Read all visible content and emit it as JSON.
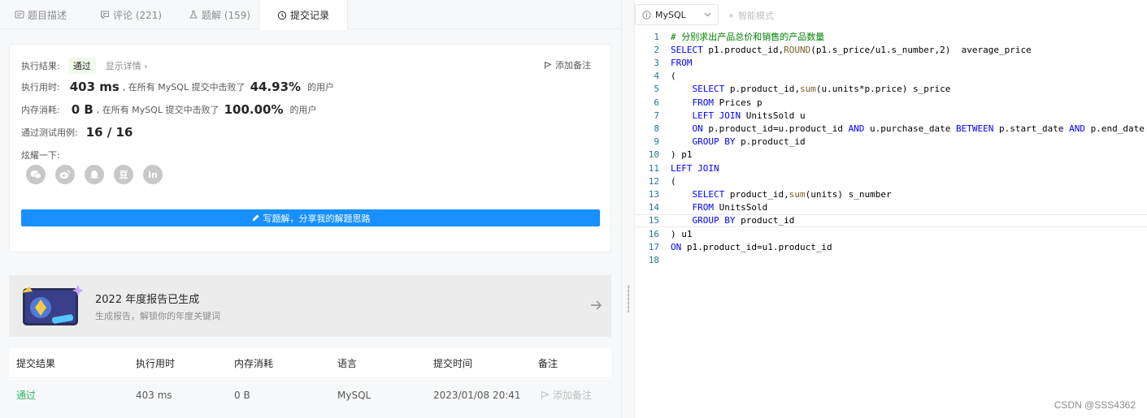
{
  "tabs": [
    {
      "label": "题目描述",
      "icon": "description-icon"
    },
    {
      "label": "评论 (221)",
      "icon": "comment-icon"
    },
    {
      "label": "题解 (159)",
      "icon": "flask-icon"
    },
    {
      "label": "提交记录",
      "icon": "clock-icon"
    }
  ],
  "result": {
    "result_label": "执行结果:",
    "status": "通过",
    "detail_link": "显示详情",
    "add_note": "添加备注",
    "time_label": "执行用时:",
    "time_value": "403 ms",
    "time_text": ", 在所有 MySQL 提交中击败了",
    "time_percent": "44.93%",
    "users_text": "的用户",
    "mem_label": "内存消耗:",
    "mem_value": "0 B",
    "mem_text": ", 在所有 MySQL 提交中击败了",
    "mem_percent": "100.00%",
    "cases_label": "通过测试用例:",
    "cases_value": "16  /  16",
    "share_label": "炫耀一下:",
    "share_icons": [
      "wechat-icon",
      "weibo-icon",
      "qq-icon",
      "douban-icon",
      "linkedin-icon"
    ],
    "douban_glyph": "豆",
    "linkedin_glyph": "in",
    "write_button": "写题解，分享我的解题思路"
  },
  "banner": {
    "title": "2022 年度报告已生成",
    "subtitle": "生成报告，解锁你的年度关键词"
  },
  "submissions": {
    "headers": [
      "提交结果",
      "执行用时",
      "内存消耗",
      "语言",
      "提交时间",
      "备注"
    ],
    "rows": [
      {
        "status": "通过",
        "time": "403 ms",
        "memory": "0 B",
        "language": "MySQL",
        "submitted": "2023/01/08 20:41",
        "note": "添加备注"
      }
    ]
  },
  "editor": {
    "language": "MySQL",
    "smart_mode": "智能模式",
    "current_line": 15,
    "lines": [
      "# 分别求出产品总价和销售的产品数量",
      "SELECT p1.product_id,ROUND(p1.s_price/u1.s_number,2)  average_price",
      "FROM",
      "(",
      "    SELECT p.product_id,sum(u.units*p.price) s_price",
      "    FROM Prices p",
      "    LEFT JOIN UnitsSold u",
      "    ON p.product_id=u.product_id AND u.purchase_date BETWEEN p.start_date AND p.end_date",
      "    GROUP BY p.product_id",
      ") p1",
      "LEFT JOIN",
      "(",
      "    SELECT product_id,sum(units) s_number",
      "    FROM UnitsSold",
      "    GROUP BY product_id",
      ") u1",
      "ON p1.product_id=u1.product_id",
      ""
    ]
  },
  "watermark": "CSDN @SSS4362",
  "colors": {
    "accent": "#1890ff",
    "pass": "#2db55d",
    "keyword": "#0000ff",
    "comment": "#008000",
    "line_number": "#237893"
  }
}
